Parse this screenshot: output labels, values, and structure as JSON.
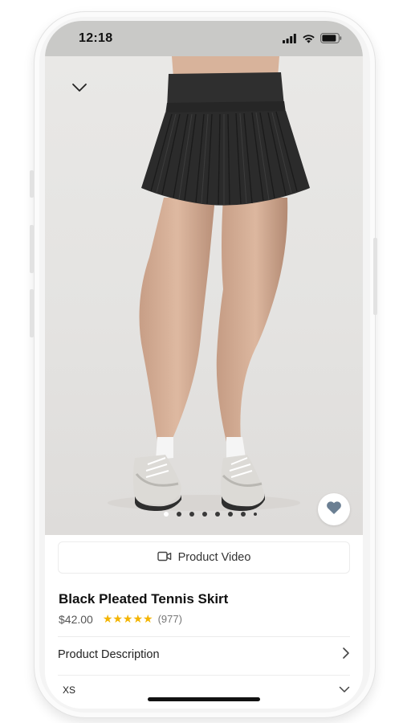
{
  "status_bar": {
    "time": "12:18",
    "icons": [
      "signal-icon",
      "wifi-icon",
      "battery-icon"
    ]
  },
  "hero": {
    "collapse_icon": "chevron-down-icon",
    "favorite_icon": "heart-icon",
    "carousel": {
      "total": 8,
      "active_index": 0
    }
  },
  "video_button": {
    "label": "Product Video",
    "icon": "video-camera-icon"
  },
  "product": {
    "title": "Black Pleated Tennis Skirt",
    "price": "$42.00",
    "stars": "★★★★★",
    "rating_count": "(977)"
  },
  "description_row": {
    "label": "Product Description",
    "icon": "chevron-right-icon"
  },
  "size_select": {
    "value": "XS",
    "icon": "chevron-down-icon"
  },
  "colors": {
    "star": "#f3b400",
    "heart": "#6b7f93",
    "status_bar_bg": "#c9c9c7"
  }
}
